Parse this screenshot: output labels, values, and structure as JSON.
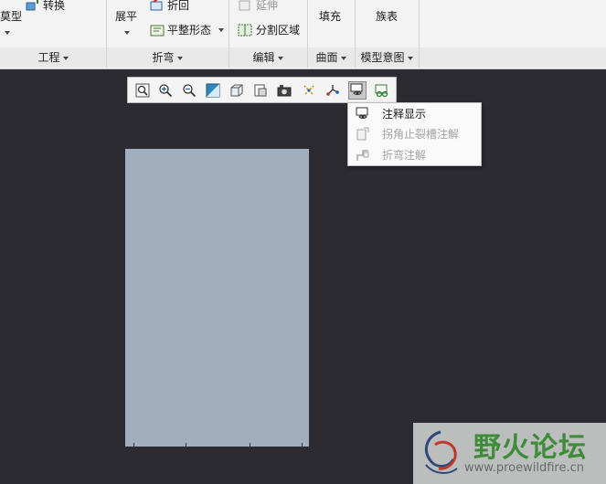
{
  "ribbon": {
    "model_partial": "莫型",
    "convert": "转换",
    "unfold": "展平",
    "fold_back": "折回",
    "flat_pattern": "平整形态",
    "extend": "延伸",
    "split_area": "分割区域",
    "fill": "填充",
    "family_table": "族表",
    "groups": {
      "engineering": "工程",
      "bend": "折弯",
      "edit": "编辑",
      "surface": "曲面",
      "model_intent": "模型意图"
    }
  },
  "graphics_toolbar": {
    "buttons": [
      "zoom-fit-icon",
      "zoom-in-icon",
      "zoom-out-icon",
      "repaint-icon",
      "display-style-icon",
      "saved-views-icon",
      "view-manager-icon",
      "datum-display-icon",
      "spin-center-icon",
      "annotation-display-icon",
      "sheetmetal-display-icon"
    ]
  },
  "annotation_menu": {
    "items": [
      {
        "label": "注释显示",
        "enabled": true,
        "icon": "annotation-display-icon"
      },
      {
        "label": "拐角止裂槽注解",
        "enabled": false,
        "icon": "corner-relief-note-icon"
      },
      {
        "label": "折弯注解",
        "enabled": false,
        "icon": "bend-note-icon"
      }
    ]
  },
  "watermark": {
    "title": "野火论坛",
    "url": "www.proewildfire.cn"
  },
  "colors": {
    "background": "#2b2b31",
    "ribbon": "#f3f3f3",
    "sheet": "#a1aebe",
    "watermark_green": "#3e8c3a"
  }
}
